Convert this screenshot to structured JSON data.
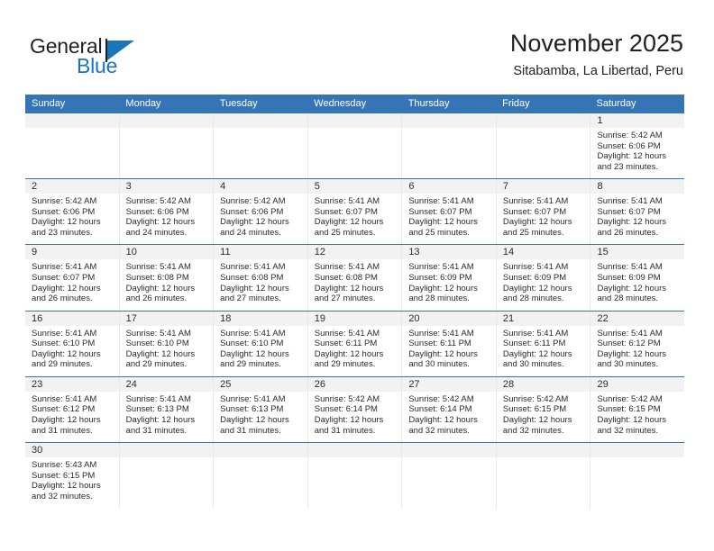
{
  "brand": {
    "name_top": "General",
    "name_bottom": "Blue",
    "accent_color": "#1b75bb"
  },
  "header": {
    "title": "November 2025",
    "subtitle": "Sitabamba, La Libertad, Peru"
  },
  "calendar": {
    "header_color": "#3575b5",
    "daynum_band_color": "#f2f2f2",
    "weekday_headers": [
      "Sunday",
      "Monday",
      "Tuesday",
      "Wednesday",
      "Thursday",
      "Friday",
      "Saturday"
    ],
    "weeks": [
      [
        {
          "day": "",
          "empty": true
        },
        {
          "day": "",
          "empty": true
        },
        {
          "day": "",
          "empty": true
        },
        {
          "day": "",
          "empty": true
        },
        {
          "day": "",
          "empty": true
        },
        {
          "day": "",
          "empty": true
        },
        {
          "day": "1",
          "sunrise": "Sunrise: 5:42 AM",
          "sunset": "Sunset: 6:06 PM",
          "daylight_1": "Daylight: 12 hours",
          "daylight_2": "and 23 minutes."
        }
      ],
      [
        {
          "day": "2",
          "sunrise": "Sunrise: 5:42 AM",
          "sunset": "Sunset: 6:06 PM",
          "daylight_1": "Daylight: 12 hours",
          "daylight_2": "and 23 minutes."
        },
        {
          "day": "3",
          "sunrise": "Sunrise: 5:42 AM",
          "sunset": "Sunset: 6:06 PM",
          "daylight_1": "Daylight: 12 hours",
          "daylight_2": "and 24 minutes."
        },
        {
          "day": "4",
          "sunrise": "Sunrise: 5:42 AM",
          "sunset": "Sunset: 6:06 PM",
          "daylight_1": "Daylight: 12 hours",
          "daylight_2": "and 24 minutes."
        },
        {
          "day": "5",
          "sunrise": "Sunrise: 5:41 AM",
          "sunset": "Sunset: 6:07 PM",
          "daylight_1": "Daylight: 12 hours",
          "daylight_2": "and 25 minutes."
        },
        {
          "day": "6",
          "sunrise": "Sunrise: 5:41 AM",
          "sunset": "Sunset: 6:07 PM",
          "daylight_1": "Daylight: 12 hours",
          "daylight_2": "and 25 minutes."
        },
        {
          "day": "7",
          "sunrise": "Sunrise: 5:41 AM",
          "sunset": "Sunset: 6:07 PM",
          "daylight_1": "Daylight: 12 hours",
          "daylight_2": "and 25 minutes."
        },
        {
          "day": "8",
          "sunrise": "Sunrise: 5:41 AM",
          "sunset": "Sunset: 6:07 PM",
          "daylight_1": "Daylight: 12 hours",
          "daylight_2": "and 26 minutes."
        }
      ],
      [
        {
          "day": "9",
          "sunrise": "Sunrise: 5:41 AM",
          "sunset": "Sunset: 6:07 PM",
          "daylight_1": "Daylight: 12 hours",
          "daylight_2": "and 26 minutes."
        },
        {
          "day": "10",
          "sunrise": "Sunrise: 5:41 AM",
          "sunset": "Sunset: 6:08 PM",
          "daylight_1": "Daylight: 12 hours",
          "daylight_2": "and 26 minutes."
        },
        {
          "day": "11",
          "sunrise": "Sunrise: 5:41 AM",
          "sunset": "Sunset: 6:08 PM",
          "daylight_1": "Daylight: 12 hours",
          "daylight_2": "and 27 minutes."
        },
        {
          "day": "12",
          "sunrise": "Sunrise: 5:41 AM",
          "sunset": "Sunset: 6:08 PM",
          "daylight_1": "Daylight: 12 hours",
          "daylight_2": "and 27 minutes."
        },
        {
          "day": "13",
          "sunrise": "Sunrise: 5:41 AM",
          "sunset": "Sunset: 6:09 PM",
          "daylight_1": "Daylight: 12 hours",
          "daylight_2": "and 28 minutes."
        },
        {
          "day": "14",
          "sunrise": "Sunrise: 5:41 AM",
          "sunset": "Sunset: 6:09 PM",
          "daylight_1": "Daylight: 12 hours",
          "daylight_2": "and 28 minutes."
        },
        {
          "day": "15",
          "sunrise": "Sunrise: 5:41 AM",
          "sunset": "Sunset: 6:09 PM",
          "daylight_1": "Daylight: 12 hours",
          "daylight_2": "and 28 minutes."
        }
      ],
      [
        {
          "day": "16",
          "sunrise": "Sunrise: 5:41 AM",
          "sunset": "Sunset: 6:10 PM",
          "daylight_1": "Daylight: 12 hours",
          "daylight_2": "and 29 minutes."
        },
        {
          "day": "17",
          "sunrise": "Sunrise: 5:41 AM",
          "sunset": "Sunset: 6:10 PM",
          "daylight_1": "Daylight: 12 hours",
          "daylight_2": "and 29 minutes."
        },
        {
          "day": "18",
          "sunrise": "Sunrise: 5:41 AM",
          "sunset": "Sunset: 6:10 PM",
          "daylight_1": "Daylight: 12 hours",
          "daylight_2": "and 29 minutes."
        },
        {
          "day": "19",
          "sunrise": "Sunrise: 5:41 AM",
          "sunset": "Sunset: 6:11 PM",
          "daylight_1": "Daylight: 12 hours",
          "daylight_2": "and 29 minutes."
        },
        {
          "day": "20",
          "sunrise": "Sunrise: 5:41 AM",
          "sunset": "Sunset: 6:11 PM",
          "daylight_1": "Daylight: 12 hours",
          "daylight_2": "and 30 minutes."
        },
        {
          "day": "21",
          "sunrise": "Sunrise: 5:41 AM",
          "sunset": "Sunset: 6:11 PM",
          "daylight_1": "Daylight: 12 hours",
          "daylight_2": "and 30 minutes."
        },
        {
          "day": "22",
          "sunrise": "Sunrise: 5:41 AM",
          "sunset": "Sunset: 6:12 PM",
          "daylight_1": "Daylight: 12 hours",
          "daylight_2": "and 30 minutes."
        }
      ],
      [
        {
          "day": "23",
          "sunrise": "Sunrise: 5:41 AM",
          "sunset": "Sunset: 6:12 PM",
          "daylight_1": "Daylight: 12 hours",
          "daylight_2": "and 31 minutes."
        },
        {
          "day": "24",
          "sunrise": "Sunrise: 5:41 AM",
          "sunset": "Sunset: 6:13 PM",
          "daylight_1": "Daylight: 12 hours",
          "daylight_2": "and 31 minutes."
        },
        {
          "day": "25",
          "sunrise": "Sunrise: 5:41 AM",
          "sunset": "Sunset: 6:13 PM",
          "daylight_1": "Daylight: 12 hours",
          "daylight_2": "and 31 minutes."
        },
        {
          "day": "26",
          "sunrise": "Sunrise: 5:42 AM",
          "sunset": "Sunset: 6:14 PM",
          "daylight_1": "Daylight: 12 hours",
          "daylight_2": "and 31 minutes."
        },
        {
          "day": "27",
          "sunrise": "Sunrise: 5:42 AM",
          "sunset": "Sunset: 6:14 PM",
          "daylight_1": "Daylight: 12 hours",
          "daylight_2": "and 32 minutes."
        },
        {
          "day": "28",
          "sunrise": "Sunrise: 5:42 AM",
          "sunset": "Sunset: 6:15 PM",
          "daylight_1": "Daylight: 12 hours",
          "daylight_2": "and 32 minutes."
        },
        {
          "day": "29",
          "sunrise": "Sunrise: 5:42 AM",
          "sunset": "Sunset: 6:15 PM",
          "daylight_1": "Daylight: 12 hours",
          "daylight_2": "and 32 minutes."
        }
      ],
      [
        {
          "day": "30",
          "sunrise": "Sunrise: 5:43 AM",
          "sunset": "Sunset: 6:15 PM",
          "daylight_1": "Daylight: 12 hours",
          "daylight_2": "and 32 minutes."
        },
        {
          "day": "",
          "empty": true
        },
        {
          "day": "",
          "empty": true
        },
        {
          "day": "",
          "empty": true
        },
        {
          "day": "",
          "empty": true
        },
        {
          "day": "",
          "empty": true
        },
        {
          "day": "",
          "empty": true
        }
      ]
    ]
  }
}
